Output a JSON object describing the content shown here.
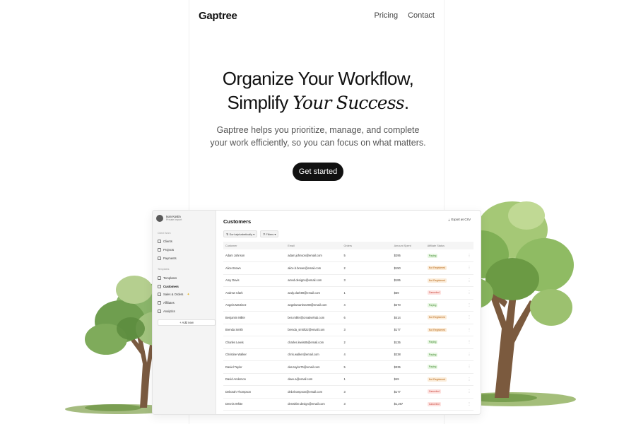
{
  "nav": {
    "logo": "Gaptree",
    "links": [
      "Pricing",
      "Contact"
    ]
  },
  "hero": {
    "line1": "Organize Your Workflow,",
    "line2_plain": "Simplify",
    "line2_italic": "Your Success",
    "line2_end": ".",
    "description_line1": "Gaptree helps you prioritize, manage, and complete",
    "description_line2": "your work efficiently, so you can focus on what matters.",
    "cta": "Get started"
  },
  "app": {
    "user": {
      "name": "Ivan Kostin",
      "subtitle": "Private Import"
    },
    "sidebar": {
      "section1": "Client Work",
      "items1": [
        "Clients",
        "Projects",
        "Payments"
      ],
      "section2": "Templates",
      "items2": [
        "Templates",
        "Customers",
        "Sales & Orders",
        "Affiliates",
        "Analytics"
      ],
      "add_new": "+ Add new"
    },
    "title": "Customers",
    "export_label": "Export as CSV",
    "toolbar": {
      "sort": "Sort alphabetically",
      "filters": "Filters"
    },
    "table": {
      "columns": [
        "Customer",
        "Email",
        "Orders",
        "Amount Spent",
        "Affiliate Status"
      ],
      "rows": [
        [
          "Adam Johnson",
          "adam.johnson@email.com",
          "5",
          "$295",
          "Paying"
        ],
        [
          "Alice Brown",
          "alice.b.brown@email.com",
          "2",
          "$150",
          "Not Registered"
        ],
        [
          "Amy Davis",
          "amvd.designs@email.com",
          "3",
          "$185",
          "Not Registered"
        ],
        [
          "Andrew Clark",
          "andy.clark90@email.com",
          "1",
          "$59",
          "Canceled"
        ],
        [
          "Angela Martinez",
          "angelamartinez88@email.com",
          "4",
          "$270",
          "Paying"
        ],
        [
          "Benjamin Miller",
          "ben.miller@creativehub.com",
          "6",
          "$414",
          "Not Registered"
        ],
        [
          "Brenda Smith",
          "brenda_smith22@email.com",
          "3",
          "$177",
          "Not Registered"
        ],
        [
          "Charles Lewis",
          "charles.lewis85@email.com",
          "2",
          "$135",
          "Paying"
        ],
        [
          "Christine Walker",
          "chris.walker@email.com",
          "4",
          "$238",
          "Paying"
        ],
        [
          "Daniel Taylor",
          "dan.taylor75@email.com",
          "5",
          "$335",
          "Paying"
        ],
        [
          "David Anderson",
          "dave.a@email.com",
          "1",
          "$49",
          "Not Registered"
        ],
        [
          "Deborah Thompson",
          "deb.thompson@email.com",
          "3",
          "$177",
          "Canceled"
        ],
        [
          "Dennis White",
          "denwhite.design@email.com",
          "3",
          "$1,267",
          "Canceled"
        ]
      ]
    }
  },
  "colors": {
    "accent": "#111111",
    "paying": "#3f8a2e",
    "not_registered": "#b86a1a",
    "canceled": "#c94035"
  },
  "icons": [
    "user-avatar",
    "clients-icon",
    "projects-icon",
    "payments-icon",
    "templates-icon",
    "customers-icon",
    "sales-icon",
    "affiliates-icon",
    "analytics-icon",
    "export-icon",
    "sort-icon",
    "filter-icon",
    "more-icon",
    "tree-illustration"
  ]
}
